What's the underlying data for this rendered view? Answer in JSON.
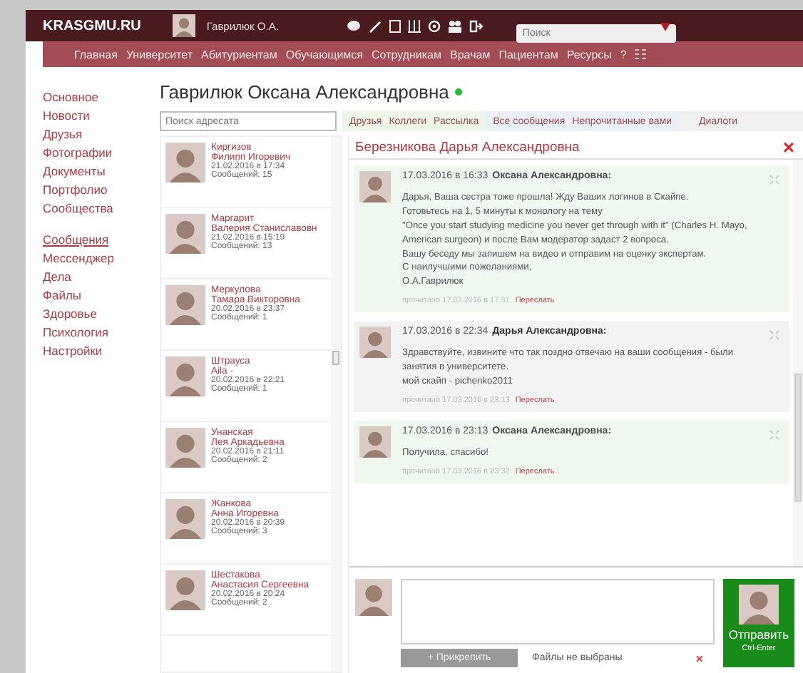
{
  "header": {
    "logo": "KRASGMU.RU",
    "user": "Гаврилюк О.А.",
    "search": {
      "placeholder": "Поиск"
    }
  },
  "nav": [
    "Главная",
    "Университет",
    "Абитуриентам",
    "Обучающимся",
    "Сотрудникам",
    "Врачам",
    "Пациентам",
    "Ресурсы",
    "?"
  ],
  "sidebar": {
    "sections": [
      [
        {
          "label": "Основное",
          "selected": false
        },
        {
          "label": "Новости",
          "selected": false
        },
        {
          "label": "Друзья",
          "selected": false
        },
        {
          "label": "Фотографии",
          "selected": false
        },
        {
          "label": "Документы",
          "selected": false
        },
        {
          "label": "Портфолио",
          "selected": false
        },
        {
          "label": "Сообщества",
          "selected": false
        }
      ],
      [
        {
          "label": "Сообщения",
          "selected": true
        },
        {
          "label": "Мессенджер",
          "selected": false
        },
        {
          "label": "Дела",
          "selected": false
        },
        {
          "label": "Файлы",
          "selected": false
        },
        {
          "label": "Здоровье",
          "selected": false
        },
        {
          "label": "Психология",
          "selected": false
        },
        {
          "label": "Настройки",
          "selected": false
        }
      ]
    ]
  },
  "profile": {
    "name": "Гаврилюк Оксана Александровна",
    "online": true
  },
  "recipient_search": {
    "placeholder": "Поиск адресата"
  },
  "tab_groups": [
    {
      "kind": "contacts",
      "tabs": [
        "Друзья",
        "Коллеги",
        "Рассылка"
      ]
    },
    {
      "kind": "messages",
      "tabs": [
        "Все сообщения",
        "Непрочитанные вами"
      ]
    },
    {
      "kind": "dialogs",
      "tabs": [
        "Диалоги"
      ]
    }
  ],
  "contacts": [
    {
      "surname": "Киргизов",
      "name": "Филипп Игоревич",
      "date": "21.02.2016 в 17:34",
      "count": "Сообщений: 15"
    },
    {
      "surname": "Маргарит",
      "name": "Валерия Станиславовн",
      "date": "21.02.2016 в 15:19",
      "count": "Сообщений: 13"
    },
    {
      "surname": "Меркулова",
      "name": "Тамара Викторовна",
      "date": "20.02.2016 в 23:37",
      "count": "Сообщений: 1"
    },
    {
      "surname": "Штрауса",
      "name": "Aila -",
      "date": "20.02.2016 в 22:21",
      "count": "Сообщений: 1"
    },
    {
      "surname": "Унанская",
      "name": "Лея Аркадьевна",
      "date": "20.02.2016 в 21:11",
      "count": "Сообщений: 2"
    },
    {
      "surname": "Жанкова",
      "name": "Анна Игоревна",
      "date": "20.02.2016 в 20:39",
      "count": "Сообщений: 3"
    },
    {
      "surname": "Шестакова",
      "name": "Анастасия Сергеевна",
      "date": "20.02.2016 в 20:24",
      "count": "Сообщений: 2"
    }
  ],
  "chat": {
    "title": "Березникова Дарья Александровна",
    "close": "×",
    "messages": [
      {
        "kind": "outgoing",
        "date": "17.03.2016 в 16:33",
        "author": "Оксана Александровна:",
        "text": "Дарья, Ваша сестра тоже прошла! Жду Ваших логинов в Скайпе.\nГотовьтесь на 1, 5 минуты к монологу на тему\n\"Once you start studying medicine you never get through with it\" (Charles H. Mayo, American surgeon) и после Вам модератор задаст 2 вопроса.\nВашу беседу мы запишем на видео и отправим на оценку экспертам.\nС наилучшими пожеланиями,\nО.А.Гаврилюк",
        "read": "прочитано 17.03.2016 в 17:31",
        "forward": "Переслать"
      },
      {
        "kind": "incoming",
        "date": "17.03.2016 в 22:34",
        "author": "Дарья Александровна:",
        "text": "Здравствуйте, извините что так поздно отвечаю на ваши сообщения - были занятия в университете.\nмой скайп - pichenko2011",
        "read": "прочитано 17.03.2016 в 23:13",
        "forward": "Переслать"
      },
      {
        "kind": "outgoing",
        "date": "17.03.2016 в 23:13",
        "author": "Оксана Александровна:",
        "text": "Получила, спасибо!",
        "read": "прочитано 17.03.2016 в 23:32",
        "forward": "Переслать"
      }
    ]
  },
  "compose": {
    "attach": "+ Прикрепить",
    "files": "Файлы не выбраны",
    "remove": "×",
    "send": "Отправить",
    "shortcut": "Ctrl-Enter"
  }
}
